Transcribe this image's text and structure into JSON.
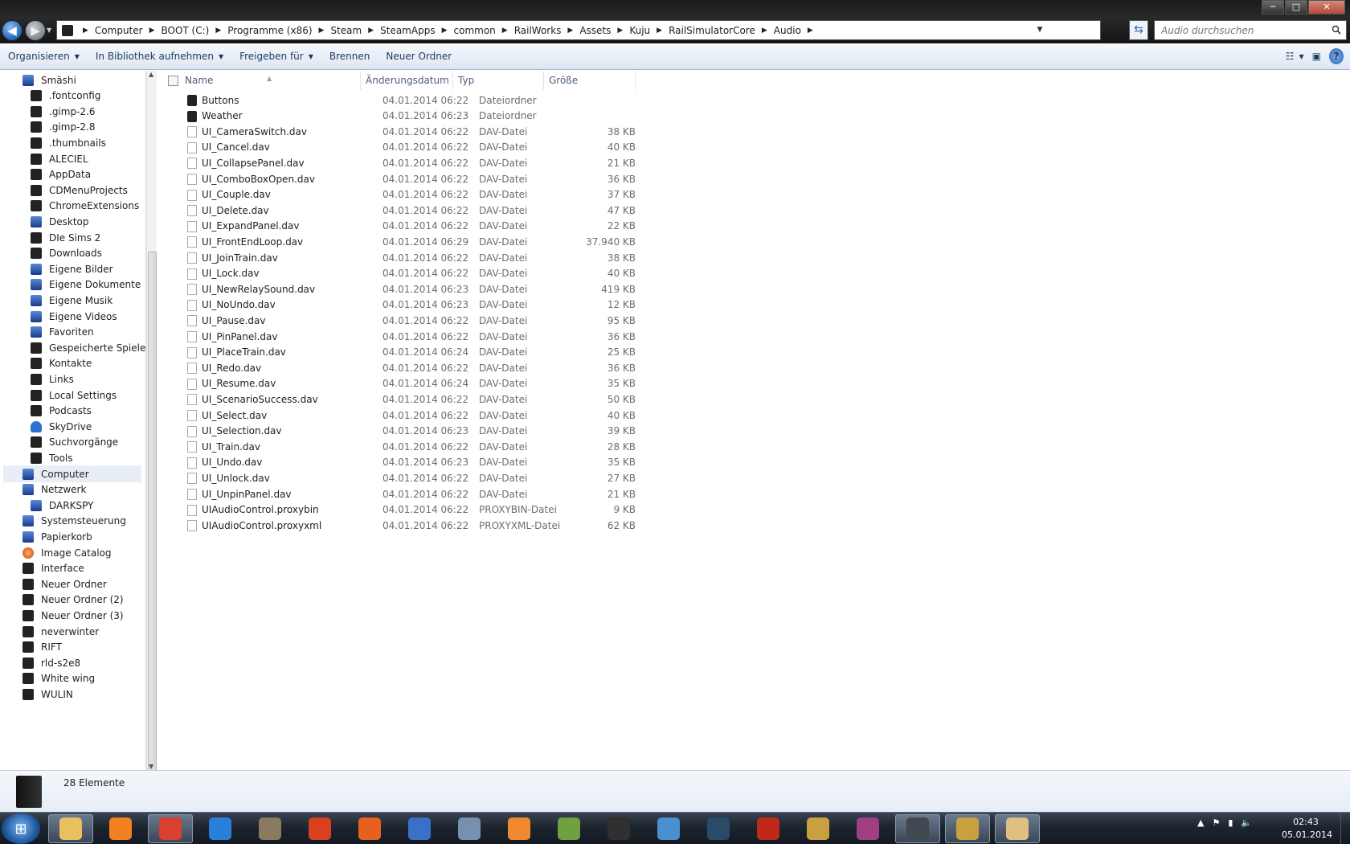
{
  "window": {
    "minimize": "─",
    "maximize": "□",
    "close": "✕"
  },
  "address": {
    "crumbs": [
      "Computer",
      "BOOT (C:)",
      "Programme (x86)",
      "Steam",
      "SteamApps",
      "common",
      "RailWorks",
      "Assets",
      "Kuju",
      "RailSimulatorCore",
      "Audio"
    ],
    "search_placeholder": "Audio durchsuchen"
  },
  "toolbar": {
    "organize": "Organisieren",
    "include_library": "In Bibliothek aufnehmen",
    "share": "Freigeben für",
    "burn": "Brennen",
    "new_folder": "Neuer Ordner"
  },
  "nav": {
    "items": [
      {
        "label": "Smäshi",
        "indent": 1,
        "icon": "user-folder-icon"
      },
      {
        "label": ".fontconfig",
        "indent": 2,
        "icon": "folder-icon"
      },
      {
        "label": ".gimp-2.6",
        "indent": 2,
        "icon": "folder-icon"
      },
      {
        "label": ".gimp-2.8",
        "indent": 2,
        "icon": "folder-icon"
      },
      {
        "label": ".thumbnails",
        "indent": 2,
        "icon": "folder-icon"
      },
      {
        "label": "ALECIEL",
        "indent": 2,
        "icon": "folder-icon"
      },
      {
        "label": "AppData",
        "indent": 2,
        "icon": "folder-icon"
      },
      {
        "label": "CDMenuProjects",
        "indent": 2,
        "icon": "folder-icon"
      },
      {
        "label": "ChromeExtensions",
        "indent": 2,
        "icon": "folder-icon"
      },
      {
        "label": "Desktop",
        "indent": 2,
        "icon": "desktop-icon"
      },
      {
        "label": "DIe Sims 2",
        "indent": 2,
        "icon": "folder-icon"
      },
      {
        "label": "Downloads",
        "indent": 2,
        "icon": "downloads-icon"
      },
      {
        "label": "Eigene Bilder",
        "indent": 2,
        "icon": "pictures-icon"
      },
      {
        "label": "Eigene Dokumente",
        "indent": 2,
        "icon": "documents-icon"
      },
      {
        "label": "Eigene Musik",
        "indent": 2,
        "icon": "music-icon"
      },
      {
        "label": "Eigene Videos",
        "indent": 2,
        "icon": "videos-icon"
      },
      {
        "label": "Favoriten",
        "indent": 2,
        "icon": "favorites-icon"
      },
      {
        "label": "Gespeicherte Spiele",
        "indent": 2,
        "icon": "saved-games-icon"
      },
      {
        "label": "Kontakte",
        "indent": 2,
        "icon": "contacts-icon"
      },
      {
        "label": "Links",
        "indent": 2,
        "icon": "links-icon"
      },
      {
        "label": "Local Settings",
        "indent": 2,
        "icon": "folder-icon"
      },
      {
        "label": "Podcasts",
        "indent": 2,
        "icon": "folder-icon"
      },
      {
        "label": "SkyDrive",
        "indent": 2,
        "icon": "skydrive-icon"
      },
      {
        "label": "Suchvorgänge",
        "indent": 2,
        "icon": "searches-icon"
      },
      {
        "label": "Tools",
        "indent": 2,
        "icon": "folder-icon"
      },
      {
        "label": "Computer",
        "indent": 1,
        "icon": "computer-icon",
        "selected": true
      },
      {
        "label": "Netzwerk",
        "indent": 1,
        "icon": "network-icon"
      },
      {
        "label": "DARKSPY",
        "indent": 2,
        "icon": "network-computer-icon"
      },
      {
        "label": "Systemsteuerung",
        "indent": 1,
        "icon": "control-panel-icon"
      },
      {
        "label": "Papierkorb",
        "indent": 1,
        "icon": "recycle-bin-icon"
      },
      {
        "label": "Image Catalog",
        "indent": 1,
        "icon": "image-catalog-icon"
      },
      {
        "label": "Interface",
        "indent": 1,
        "icon": "folder-icon"
      },
      {
        "label": "Neuer Ordner",
        "indent": 1,
        "icon": "folder-icon"
      },
      {
        "label": "Neuer Ordner (2)",
        "indent": 1,
        "icon": "folder-icon"
      },
      {
        "label": "Neuer Ordner (3)",
        "indent": 1,
        "icon": "folder-icon"
      },
      {
        "label": "neverwinter",
        "indent": 1,
        "icon": "folder-icon"
      },
      {
        "label": "RIFT",
        "indent": 1,
        "icon": "folder-icon"
      },
      {
        "label": "rld-s2e8",
        "indent": 1,
        "icon": "folder-icon"
      },
      {
        "label": "White wing",
        "indent": 1,
        "icon": "folder-icon"
      },
      {
        "label": "WULIN",
        "indent": 1,
        "icon": "folder-icon"
      }
    ]
  },
  "columns": {
    "name": "Name",
    "date": "Änderungsdatum",
    "type": "Typ",
    "size": "Größe"
  },
  "files": [
    {
      "name": "Buttons",
      "date": "04.01.2014 06:22",
      "type": "Dateiordner",
      "size": "",
      "kind": "folder"
    },
    {
      "name": "Weather",
      "date": "04.01.2014 06:23",
      "type": "Dateiordner",
      "size": "",
      "kind": "folder"
    },
    {
      "name": "UI_CameraSwitch.dav",
      "date": "04.01.2014 06:22",
      "type": "DAV-Datei",
      "size": "38 KB",
      "kind": "file"
    },
    {
      "name": "UI_Cancel.dav",
      "date": "04.01.2014 06:22",
      "type": "DAV-Datei",
      "size": "40 KB",
      "kind": "file"
    },
    {
      "name": "UI_CollapsePanel.dav",
      "date": "04.01.2014 06:22",
      "type": "DAV-Datei",
      "size": "21 KB",
      "kind": "file"
    },
    {
      "name": "UI_ComboBoxOpen.dav",
      "date": "04.01.2014 06:22",
      "type": "DAV-Datei",
      "size": "36 KB",
      "kind": "file"
    },
    {
      "name": "UI_Couple.dav",
      "date": "04.01.2014 06:22",
      "type": "DAV-Datei",
      "size": "37 KB",
      "kind": "file"
    },
    {
      "name": "UI_Delete.dav",
      "date": "04.01.2014 06:22",
      "type": "DAV-Datei",
      "size": "47 KB",
      "kind": "file"
    },
    {
      "name": "UI_ExpandPanel.dav",
      "date": "04.01.2014 06:22",
      "type": "DAV-Datei",
      "size": "22 KB",
      "kind": "file"
    },
    {
      "name": "UI_FrontEndLoop.dav",
      "date": "04.01.2014 06:29",
      "type": "DAV-Datei",
      "size": "37.940 KB",
      "kind": "file"
    },
    {
      "name": "UI_JoinTrain.dav",
      "date": "04.01.2014 06:22",
      "type": "DAV-Datei",
      "size": "38 KB",
      "kind": "file"
    },
    {
      "name": "UI_Lock.dav",
      "date": "04.01.2014 06:22",
      "type": "DAV-Datei",
      "size": "40 KB",
      "kind": "file"
    },
    {
      "name": "UI_NewRelaySound.dav",
      "date": "04.01.2014 06:23",
      "type": "DAV-Datei",
      "size": "419 KB",
      "kind": "file"
    },
    {
      "name": "UI_NoUndo.dav",
      "date": "04.01.2014 06:23",
      "type": "DAV-Datei",
      "size": "12 KB",
      "kind": "file"
    },
    {
      "name": "UI_Pause.dav",
      "date": "04.01.2014 06:22",
      "type": "DAV-Datei",
      "size": "95 KB",
      "kind": "file"
    },
    {
      "name": "UI_PinPanel.dav",
      "date": "04.01.2014 06:22",
      "type": "DAV-Datei",
      "size": "36 KB",
      "kind": "file"
    },
    {
      "name": "UI_PlaceTrain.dav",
      "date": "04.01.2014 06:24",
      "type": "DAV-Datei",
      "size": "25 KB",
      "kind": "file"
    },
    {
      "name": "UI_Redo.dav",
      "date": "04.01.2014 06:22",
      "type": "DAV-Datei",
      "size": "36 KB",
      "kind": "file"
    },
    {
      "name": "UI_Resume.dav",
      "date": "04.01.2014 06:24",
      "type": "DAV-Datei",
      "size": "35 KB",
      "kind": "file"
    },
    {
      "name": "UI_ScenarioSuccess.dav",
      "date": "04.01.2014 06:22",
      "type": "DAV-Datei",
      "size": "50 KB",
      "kind": "file"
    },
    {
      "name": "UI_Select.dav",
      "date": "04.01.2014 06:22",
      "type": "DAV-Datei",
      "size": "40 KB",
      "kind": "file"
    },
    {
      "name": "UI_Selection.dav",
      "date": "04.01.2014 06:23",
      "type": "DAV-Datei",
      "size": "39 KB",
      "kind": "file"
    },
    {
      "name": "UI_Train.dav",
      "date": "04.01.2014 06:22",
      "type": "DAV-Datei",
      "size": "28 KB",
      "kind": "file"
    },
    {
      "name": "UI_Undo.dav",
      "date": "04.01.2014 06:23",
      "type": "DAV-Datei",
      "size": "35 KB",
      "kind": "file"
    },
    {
      "name": "UI_Unlock.dav",
      "date": "04.01.2014 06:22",
      "type": "DAV-Datei",
      "size": "27 KB",
      "kind": "file"
    },
    {
      "name": "UI_UnpinPanel.dav",
      "date": "04.01.2014 06:22",
      "type": "DAV-Datei",
      "size": "21 KB",
      "kind": "file"
    },
    {
      "name": "UIAudioControl.proxybin",
      "date": "04.01.2014 06:22",
      "type": "PROXYBIN-Datei",
      "size": "9 KB",
      "kind": "file"
    },
    {
      "name": "UIAudioControl.proxyxml",
      "date": "04.01.2014 06:22",
      "type": "PROXYXML-Datei",
      "size": "62 KB",
      "kind": "file"
    }
  ],
  "status": {
    "count": "28 Elemente"
  },
  "taskbar": {
    "apps": [
      {
        "name": "explorer-icon",
        "color": "#e8c060",
        "active": true
      },
      {
        "name": "media-player-icon",
        "color": "#f08020"
      },
      {
        "name": "chrome-icon",
        "color": "#d84030",
        "active": true
      },
      {
        "name": "internet-explorer-icon",
        "color": "#2a80d8"
      },
      {
        "name": "gimp-icon",
        "color": "#8a7a60"
      },
      {
        "name": "ccleaner-icon",
        "color": "#d84020"
      },
      {
        "name": "flash-icon",
        "color": "#e86020"
      },
      {
        "name": "device-icon",
        "color": "#3a70c8"
      },
      {
        "name": "moon-app-icon",
        "color": "#7890b0"
      },
      {
        "name": "fire-app-icon",
        "color": "#f08830"
      },
      {
        "name": "genie-icon",
        "color": "#70a040"
      },
      {
        "name": "obs-icon",
        "color": "#303030"
      },
      {
        "name": "network-app-icon",
        "color": "#4a90d0"
      },
      {
        "name": "steam-icon",
        "color": "#2a4a6a"
      },
      {
        "name": "neverwinter-icon",
        "color": "#c02818"
      },
      {
        "name": "league-icon",
        "color": "#c8a040"
      },
      {
        "name": "rift-icon",
        "color": "#a04080"
      },
      {
        "name": "phone-icon",
        "color": "#404850",
        "active": true
      },
      {
        "name": "league-client-icon",
        "color": "#c8a040",
        "active": true
      },
      {
        "name": "paint-icon",
        "color": "#e0c080",
        "active": true
      }
    ],
    "time": "02:43",
    "date": "05.01.2014"
  }
}
